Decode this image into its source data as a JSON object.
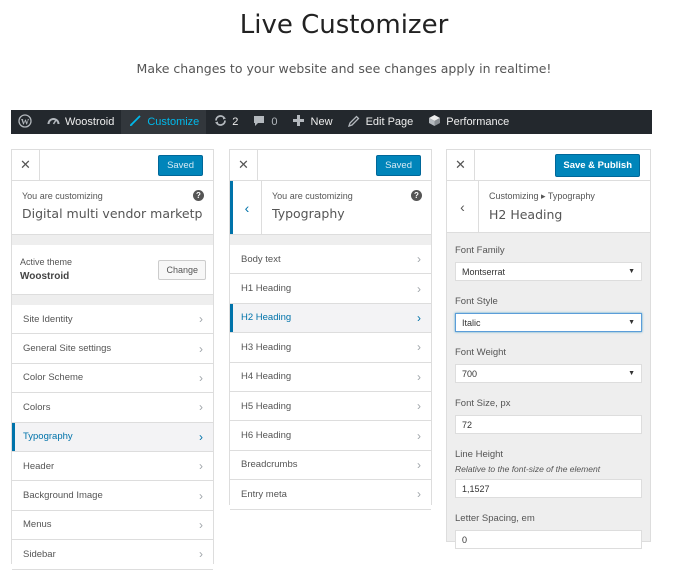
{
  "hero": {
    "title": "Live Customizer",
    "subtitle": "Make changes to your website and see changes apply in realtime!"
  },
  "adminbar": {
    "items": [
      {
        "label": "",
        "icon": "wordpress-icon"
      },
      {
        "label": "Woostroid",
        "icon": "dashboard-icon"
      },
      {
        "label": "Customize",
        "icon": "brush-icon",
        "active": true
      },
      {
        "label": "2",
        "icon": "updates-icon"
      },
      {
        "label": "0",
        "icon": "comments-icon"
      },
      {
        "label": "New",
        "icon": "plus-icon"
      },
      {
        "label": "Edit Page",
        "icon": "pencil-icon"
      },
      {
        "label": "Performance",
        "icon": "performance-icon"
      }
    ]
  },
  "panel1": {
    "saved_label": "Saved",
    "customizing_label": "You are customizing",
    "site_title": "Digital multi vendor marketpla...",
    "active_theme_label": "Active theme",
    "theme_name": "Woostroid",
    "change_label": "Change",
    "items": [
      "Site Identity",
      "General Site settings",
      "Color Scheme",
      "Colors",
      "Typography",
      "Header",
      "Background Image",
      "Menus",
      "Sidebar"
    ],
    "active_item": "Typography"
  },
  "panel2": {
    "saved_label": "Saved",
    "customizing_label": "You are customizing",
    "section_title": "Typography",
    "items": [
      "Body text",
      "H1 Heading",
      "H2 Heading",
      "H3 Heading",
      "H4 Heading",
      "H5 Heading",
      "H6 Heading",
      "Breadcrumbs",
      "Entry meta"
    ],
    "active_item": "H2 Heading"
  },
  "panel3": {
    "publish_label": "Save & Publish",
    "breadcrumb": "Customizing ▸ Typography",
    "section_title": "H2 Heading",
    "font_family_label": "Font Family",
    "font_family_value": "Montserrat",
    "font_style_label": "Font Style",
    "font_style_value": "Italic",
    "font_weight_label": "Font Weight",
    "font_weight_value": "700",
    "font_size_label": "Font Size, px",
    "font_size_value": "72",
    "line_height_label": "Line Height",
    "line_height_desc": "Relative to the font-size of the element",
    "line_height_value": "1,1527",
    "letter_spacing_label": "Letter Spacing, em",
    "letter_spacing_value": "0"
  },
  "colors": {
    "adminbar_bg": "#23282d",
    "accent": "#0085ba",
    "active_link": "#0073aa"
  }
}
